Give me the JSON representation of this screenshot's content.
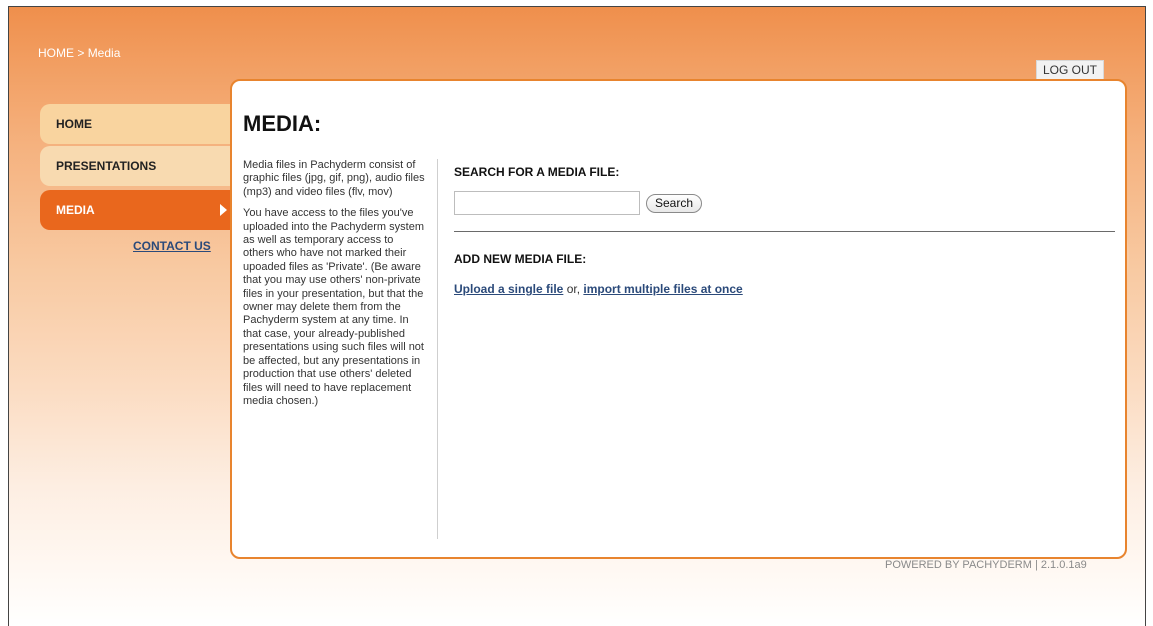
{
  "breadcrumb": {
    "home": "HOME",
    "separator": " > ",
    "current": "Media"
  },
  "header": {
    "logout_label": "LOG OUT"
  },
  "sidebar": {
    "items": [
      {
        "label": "HOME",
        "active": false
      },
      {
        "label": "PRESENTATIONS",
        "active": false
      },
      {
        "label": "MEDIA",
        "active": true
      }
    ],
    "contact_label": "CONTACT US"
  },
  "main": {
    "title": "MEDIA:",
    "intro_p1": "Media files in Pachyderm consist of graphic files (jpg, gif, png), audio files (mp3) and video files (flv, mov)",
    "intro_p2": "You have access to the files you've uploaded into the Pachyderm system as well as temporary access to others who have not marked their upoaded files as 'Private'. (Be aware that you may use others' non-private files in your presentation, but that the owner may delete them from the Pachyderm system at any time. In that case, your already-published presentations using such files will not be affected, but any presentations in production that use others' deleted files will need to have replacement media chosen.)",
    "search": {
      "heading": "SEARCH FOR A MEDIA FILE:",
      "input_value": "",
      "button_label": "Search"
    },
    "add": {
      "heading": "ADD NEW MEDIA FILE:",
      "upload_single_label": "Upload a single file",
      "connector": " or, ",
      "import_multiple_label": "import multiple files at once"
    }
  },
  "footer": {
    "text": "POWERED BY PACHYDERM | 2.1.0.1a9"
  },
  "colors": {
    "accent": "#e9671d",
    "panel_border": "#e8842e",
    "link": "#2b4a7a",
    "nav_inactive": "#f9d49f"
  }
}
